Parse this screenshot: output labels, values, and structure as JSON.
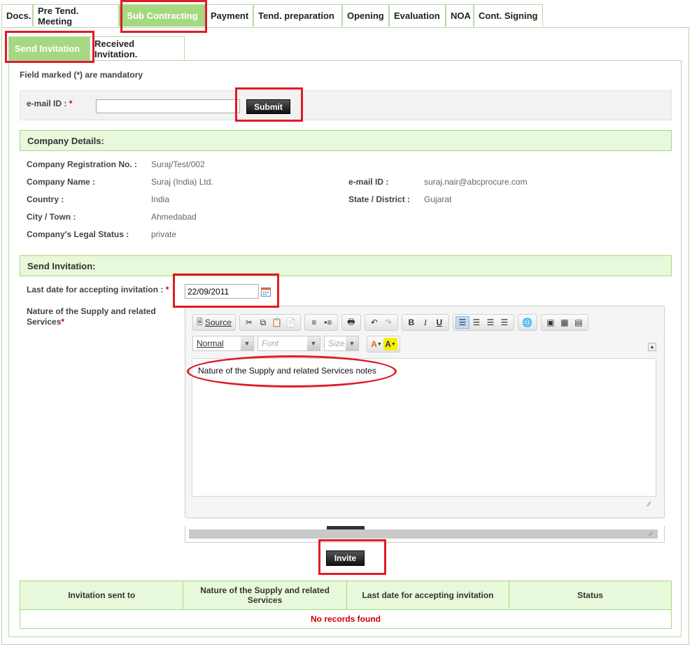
{
  "top_tabs": [
    "Docs.",
    "Pre Tend. Meeting",
    "Sub Contracting",
    "Payment",
    "Tend. preparation",
    "Opening",
    "Evaluation",
    "NOA",
    "Cont. Signing"
  ],
  "sub_tabs": [
    "Send Invitation",
    "Received Invitation."
  ],
  "mandatory_note": "Field marked (*) are mandatory",
  "email_search": {
    "label": "e-mail ID :",
    "required_mark": "*",
    "value": "",
    "submit_label": "Submit"
  },
  "company": {
    "header": "Company Details:",
    "fields": {
      "reg_no": {
        "label": "Company Registration No. :",
        "value": "Suraj/Test/002"
      },
      "name": {
        "label": "Company Name :",
        "value": "Suraj (India) Ltd."
      },
      "email": {
        "label": "e-mail ID :",
        "value": "suraj.nair@abcprocure.com"
      },
      "country": {
        "label": "Country :",
        "value": "India"
      },
      "state": {
        "label": "State / District :",
        "value": "Gujarat"
      },
      "city": {
        "label": "City / Town :",
        "value": "Ahmedabad"
      },
      "legal": {
        "label": "Company's Legal Status :",
        "value": "private"
      }
    }
  },
  "invitation": {
    "header": "Send Invitation:",
    "last_date_label": "Last date for accepting invitation :",
    "last_date_value": "22/09/2011",
    "nature_label": "Nature of the Supply and related Services",
    "required_mark": "*",
    "editor": {
      "source_label": "Source",
      "format_value": "Normal",
      "font_placeholder": "Font",
      "size_placeholder": "Size",
      "content": "Nature of the Supply and related Services notes"
    },
    "invite_label": "Invite"
  },
  "table": {
    "headers": [
      "Invitation sent to",
      "Nature of the Supply and related Services",
      "Last date for accepting invitation",
      "Status"
    ],
    "empty_message": "No records found"
  },
  "colors": {
    "accent_green": "#a5d880",
    "header_bg": "#e8f8da",
    "highlight_red": "#e01b24"
  }
}
